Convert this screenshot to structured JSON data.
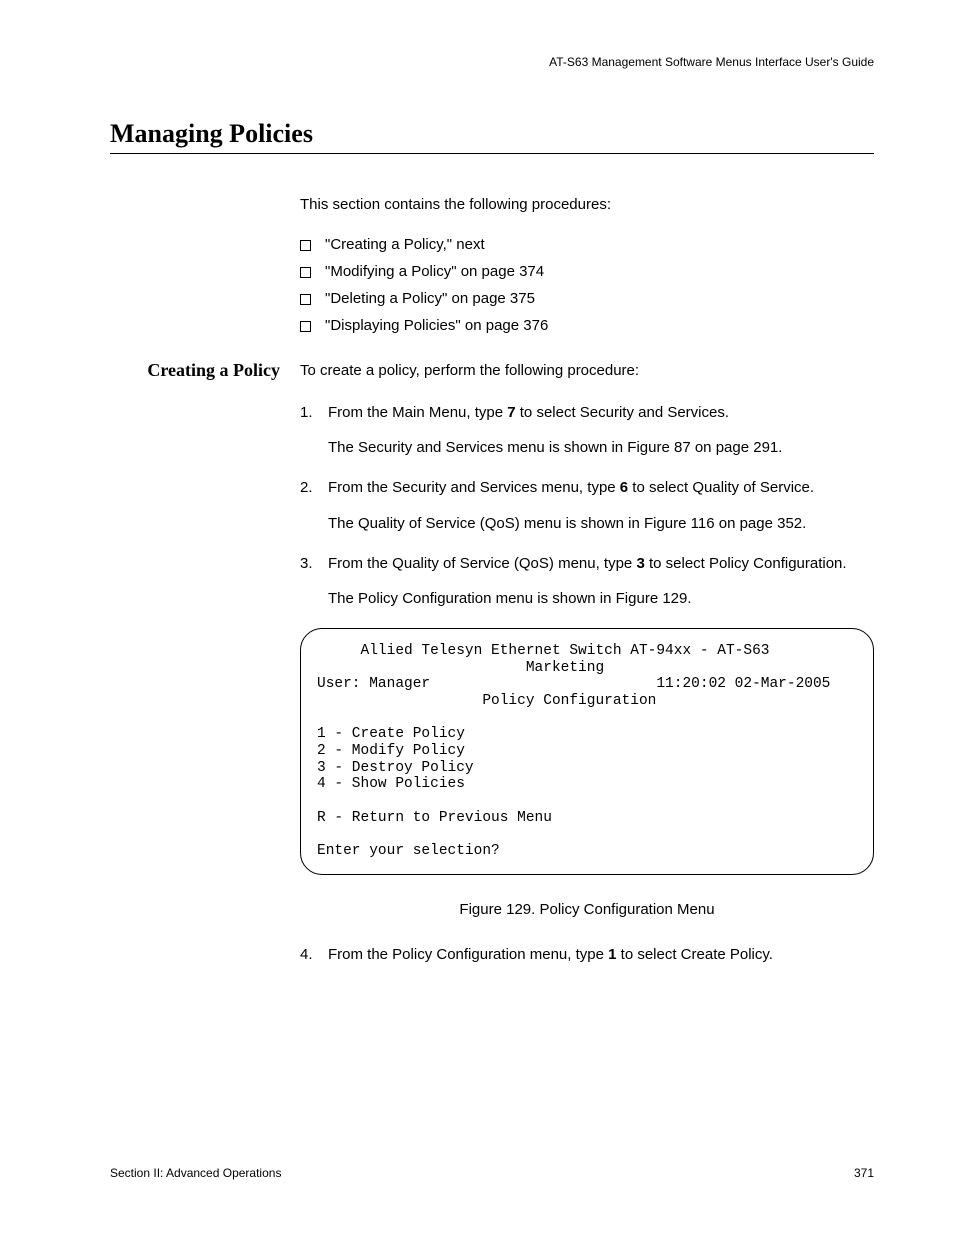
{
  "header": {
    "running": "AT-S63 Management Software Menus Interface User's Guide"
  },
  "title": "Managing Policies",
  "intro": "This section contains the following procedures:",
  "bullets": [
    "\"Creating a Policy,\"  next",
    "\"Modifying a Policy\" on page 374",
    "\"Deleting a Policy\" on page 375",
    "\"Displaying Policies\" on page 376"
  ],
  "subsection": {
    "heading": "Creating a Policy",
    "lead": "To create a policy, perform the following procedure:",
    "steps": [
      {
        "num": "1.",
        "pre": "From the Main Menu, type ",
        "bold": "7",
        "post": " to select Security and Services.",
        "note": "The Security and Services menu is shown in Figure 87 on page 291."
      },
      {
        "num": "2.",
        "pre": "From the Security and Services menu, type ",
        "bold": "6",
        "post": " to select Quality of Service.",
        "note": "The Quality of Service (QoS) menu is shown in Figure 116 on page 352."
      },
      {
        "num": "3.",
        "pre": "From the Quality of Service (QoS) menu, type ",
        "bold": "3",
        "post": " to select Policy Configuration.",
        "note": "The Policy Configuration menu is shown in Figure 129."
      }
    ],
    "menu": {
      "l1": "     Allied Telesyn Ethernet Switch AT-94xx - AT-S63",
      "l2": "                        Marketing",
      "l3": "User: Manager                          11:20:02 02-Mar-2005",
      "l4": "                   Policy Configuration",
      "l5": "1 - Create Policy",
      "l6": "2 - Modify Policy",
      "l7": "3 - Destroy Policy",
      "l8": "4 - Show Policies",
      "l9": "R - Return to Previous Menu",
      "l10": "Enter your selection?"
    },
    "figure_caption": "Figure 129. Policy Configuration Menu",
    "step4": {
      "num": "4.",
      "pre": "From the Policy Configuration menu, type ",
      "bold": "1",
      "post": " to select Create Policy."
    }
  },
  "footer": {
    "left": "Section II: Advanced Operations",
    "right": "371"
  }
}
